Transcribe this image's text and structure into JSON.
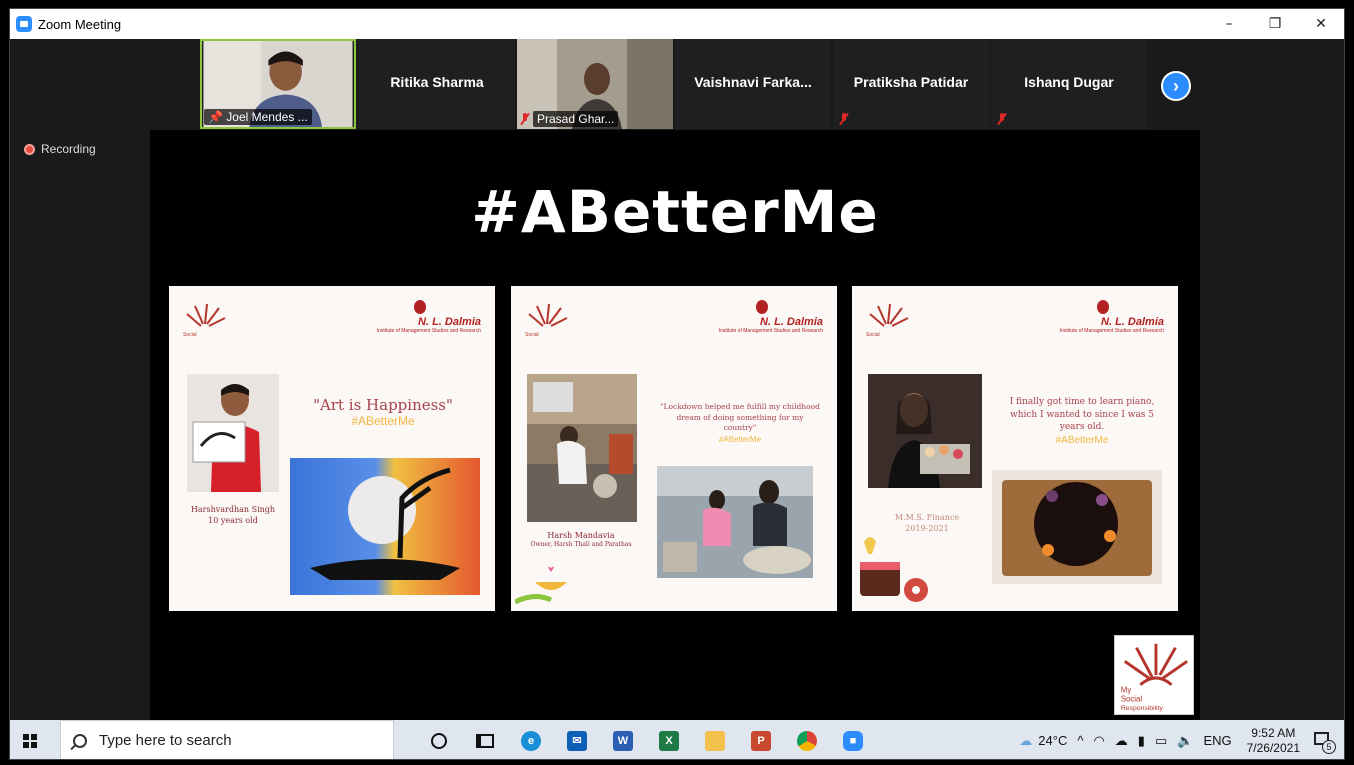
{
  "window": {
    "title": "Zoom Meeting",
    "controls": [
      "–",
      "❐",
      "✕"
    ]
  },
  "participants": [
    {
      "name": "Joel Mendes ...",
      "video": true
    },
    {
      "name": "Ritika Sharma",
      "video": false
    },
    {
      "name": "Prasad Ghar...",
      "video": true
    },
    {
      "name": "Vaishnavi  Farka...",
      "video": false
    },
    {
      "name": "Pratiksha Patidar",
      "video": false
    },
    {
      "name": "Ishanq Dugar",
      "video": false
    }
  ],
  "next_icon": "chevron-right-icon",
  "recording_label": "Recording",
  "share": {
    "headline": "#ABetterMe",
    "cards": [
      {
        "brand": "N. L. Dalmia",
        "quote": "\"Art is Happiness\"",
        "hashtag": "#ABetterMe",
        "caption_name": "Harshvardhan Singh",
        "caption_sub": "10 years old"
      },
      {
        "brand": "N. L. Dalmia",
        "quote": "\"Lockdown helped me fulfill my childhood dream of doing something for my country\"",
        "hashtag": "#ABetterMe",
        "caption_name": "Harsh Mandavia",
        "caption_sub": "Owner, Harsh Thali and Parathas"
      },
      {
        "brand": "N. L. Dalmia",
        "quote": "I finally got time to learn piano, which I wanted to since I was 5 years old.",
        "hashtag": "#ABetterMe",
        "caption_name": "M.M.S. Finance",
        "caption_sub": "2019-2021"
      }
    ]
  },
  "taskbar": {
    "search_placeholder": "Type here to search",
    "weather": "24°C",
    "language": "ENG",
    "time": "9:52 AM",
    "date": "7/26/2021",
    "notification_count": "5"
  }
}
